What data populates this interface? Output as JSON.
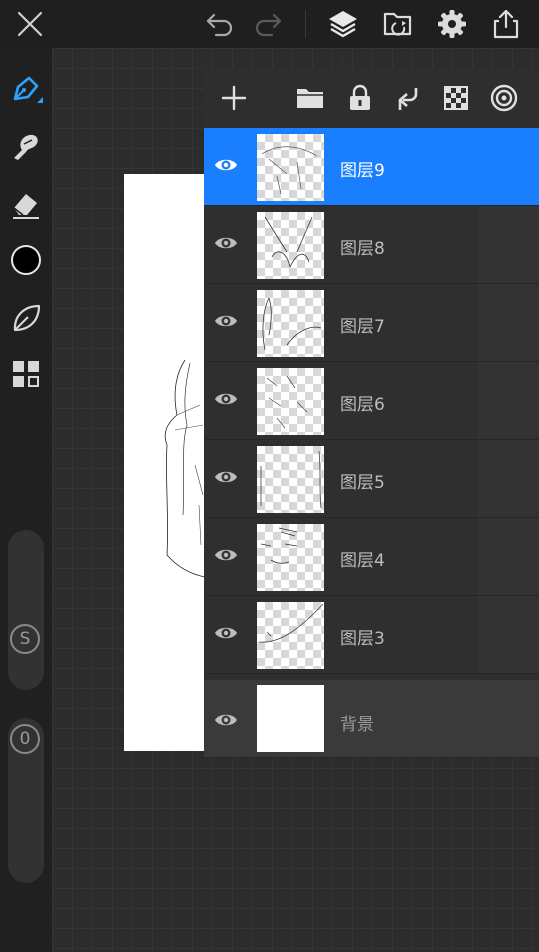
{
  "toolbar": {
    "close_icon": "close-icon",
    "undo_icon": "undo-icon",
    "redo_icon": "redo-icon",
    "layers_icon": "layers-icon",
    "import_icon": "import-image-icon",
    "settings_icon": "gear-icon",
    "share_icon": "share-icon"
  },
  "tools": {
    "items": [
      "pen-tool-icon",
      "smudge-tool-icon",
      "eraser-icon",
      "color-swatch",
      "leaf-brush-icon",
      "grid-apps-icon"
    ],
    "current_color": "#000000"
  },
  "sliders": {
    "size_label": "S",
    "opacity_label": "0"
  },
  "layers_panel": {
    "toolbar": [
      "add-layer-icon",
      "folder-icon",
      "lock-icon",
      "merge-down-icon",
      "checker-transparency-icon",
      "target-icon"
    ],
    "layers": [
      {
        "name": "图层9",
        "selected": true,
        "visible": true
      },
      {
        "name": "图层8",
        "selected": false,
        "visible": true
      },
      {
        "name": "图层7",
        "selected": false,
        "visible": true
      },
      {
        "name": "图层6",
        "selected": false,
        "visible": true
      },
      {
        "name": "图层5",
        "selected": false,
        "visible": true
      },
      {
        "name": "图层4",
        "selected": false,
        "visible": true
      },
      {
        "name": "图层3",
        "selected": false,
        "visible": true
      }
    ],
    "background": {
      "name": "背景",
      "visible": true
    }
  },
  "colors": {
    "accent": "#1a7fff",
    "pen_accent": "#2aa3ff"
  }
}
